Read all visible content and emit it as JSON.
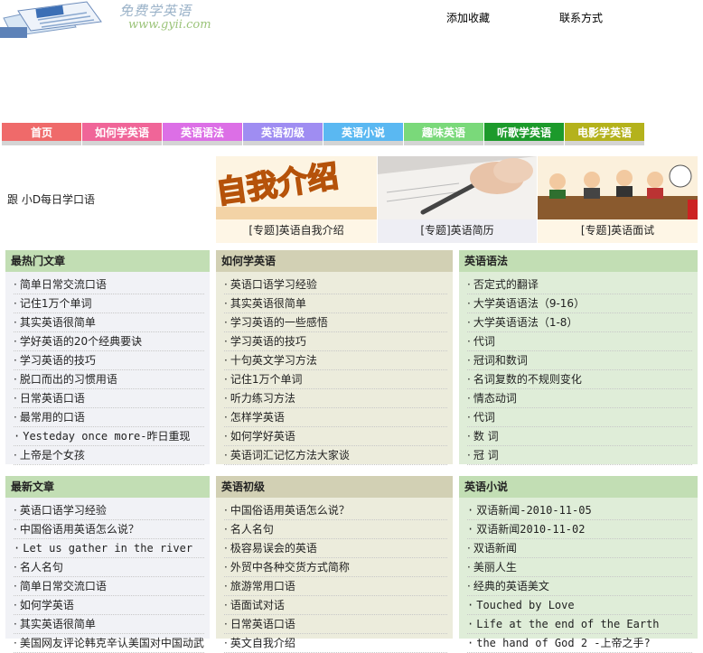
{
  "header": {
    "logo_title": "免费学英语",
    "logo_url": "www.gyii.com",
    "links": [
      "添加收藏",
      "联系方式"
    ]
  },
  "nav": [
    {
      "label": "首页",
      "color": "#ef6a6a"
    },
    {
      "label": "如何学英语",
      "color": "#f06598"
    },
    {
      "label": "英语语法",
      "color": "#dc6fe6"
    },
    {
      "label": "英语初级",
      "color": "#9f8df2"
    },
    {
      "label": "英语小说",
      "color": "#5ab8f2"
    },
    {
      "label": "趣味英语",
      "color": "#7ad97a"
    },
    {
      "label": "听歌学英语",
      "color": "#1c9a2b"
    },
    {
      "label": "电影学英语",
      "color": "#b4b21c"
    }
  ],
  "daily_label": "跟 小D每日学口语",
  "features": [
    {
      "caption": "[专题]英语自我介绍",
      "bg": "#fef6e6"
    },
    {
      "caption": "[专题]英语简历",
      "bg": "#eeeef4"
    },
    {
      "caption": "[专题]英语面试",
      "bg": "#fef6e6"
    }
  ],
  "boxes": [
    {
      "title": "最热门文章",
      "head_bg": "#c2deb4",
      "body_bg": "#f1f2f6",
      "items": [
        "简单日常交流口语",
        "记住1万个单词",
        "其实英语很简单",
        "学好英语的20个经典要诀",
        "学习英语的技巧",
        "脱口而出的习惯用语",
        "日常英语口语",
        "最常用的口语",
        "Yesteday once more-昨日重现",
        "上帝是个女孩"
      ]
    },
    {
      "title": "如何学英语",
      "head_bg": "#d2d0b4",
      "body_bg": "#ececdc",
      "items": [
        "英语口语学习经验",
        "其实英语很简单",
        "学习英语的一些感悟",
        "学习英语的技巧",
        "十句英文学习方法",
        "记住1万个单词",
        "听力练习方法",
        "怎样学英语",
        "如何学好英语",
        "英语词汇记忆方法大家谈"
      ]
    },
    {
      "title": "英语语法",
      "head_bg": "#c2deb4",
      "body_bg": "#dfedd8",
      "items": [
        "否定式的翻译",
        "大学英语语法（9-16）",
        "大学英语语法（1-8）",
        "代词",
        "冠词和数词",
        "名词复数的不规则变化",
        "情态动词",
        "代词",
        "数 词",
        "冠 词"
      ]
    },
    {
      "title": "最新文章",
      "head_bg": "#c2deb4",
      "body_bg": "#f1f2f6",
      "items": [
        "英语口语学习经验",
        "中国俗语用英语怎么说？",
        "Let us gather in the river",
        "名人名句",
        "简单日常交流口语",
        "如何学英语",
        "其实英语很简单",
        "美国网友评论韩克辛认美国对中国动武"
      ]
    },
    {
      "title": "英语初级",
      "head_bg": "#d2d0b4",
      "body_bg": "#ececdc",
      "items": [
        "中国俗语用英语怎么说？",
        "名人名句",
        "极容易误会的英语",
        "外贸中各种交货方式简称",
        "旅游常用口语",
        "语面试对话",
        "日常英语口语",
        "英文自我介绍"
      ]
    },
    {
      "title": "英语小说",
      "head_bg": "#c2deb4",
      "body_bg": "#dfedd8",
      "items": [
        "双语新闻-2010-11-05",
        "双语新闻2010-11-02",
        "双语新闻",
        "美丽人生",
        "经典的英语美文",
        "Touched by Love",
        "Life at the end of the Earth",
        "the hand of God 2 -上帝之手?"
      ]
    }
  ]
}
